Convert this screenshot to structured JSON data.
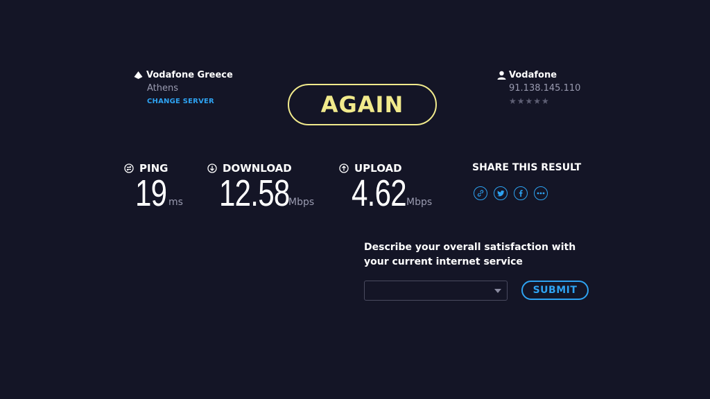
{
  "server": {
    "name": "Vodafone Greece",
    "location": "Athens",
    "change_label": "CHANGE SERVER",
    "icon": "globe-marker-icon"
  },
  "isp": {
    "name": "Vodafone",
    "ip": "91.138.145.110",
    "rating_stars": "★★★★★",
    "rating": 0,
    "icon": "user-icon"
  },
  "again_label": "AGAIN",
  "metrics": {
    "ping": {
      "label": "PING",
      "value": "19",
      "unit": "ms"
    },
    "download": {
      "label": "DOWNLOAD",
      "value": "12.58",
      "unit": "Mbps"
    },
    "upload": {
      "label": "UPLOAD",
      "value": "4.62",
      "unit": "Mbps"
    }
  },
  "share": {
    "title": "SHARE THIS RESULT",
    "icons": [
      "link-icon",
      "twitter-icon",
      "facebook-icon",
      "more-icon"
    ]
  },
  "survey": {
    "question": "Describe your overall satisfaction with your current internet service",
    "selected": "",
    "submit_label": "SUBMIT"
  },
  "colors": {
    "background": "#141526",
    "accent_yellow": "#f1ea8c",
    "accent_blue": "#2ea3f2",
    "muted_text": "#9a9bb0"
  }
}
